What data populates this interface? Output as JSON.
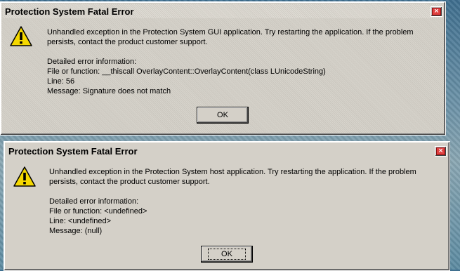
{
  "dialogs": [
    {
      "title": "Protection System Fatal Error",
      "close_label": "×",
      "message_line1": "Unhandled exception in the Protection System GUI application. Try restarting the application. If the problem persists, contact the product customer support.",
      "details_heading": "Detailed error information:",
      "file_line": "File or function: __thiscall OverlayContent::OverlayContent(class LUnicodeString)",
      "line_line": "Line: 56",
      "message_line": "Message: Signature does not match",
      "ok_label": "OK",
      "icon": "warning-icon"
    },
    {
      "title": "Protection System Fatal Error",
      "close_label": "×",
      "message_line1": "Unhandled exception in the Protection System host application. Try restarting the application. If the problem persists, contact the product customer support.",
      "details_heading": "Detailed error information:",
      "file_line": "File or function: <undefined>",
      "line_line": "Line: <undefined>",
      "message_line": "Message: (null)",
      "ok_label": "OK",
      "icon": "warning-icon"
    }
  ],
  "colors": {
    "dialog_bg": "#d4d0c8",
    "warning_yellow": "#f5d800",
    "close_red": "#e04040"
  }
}
